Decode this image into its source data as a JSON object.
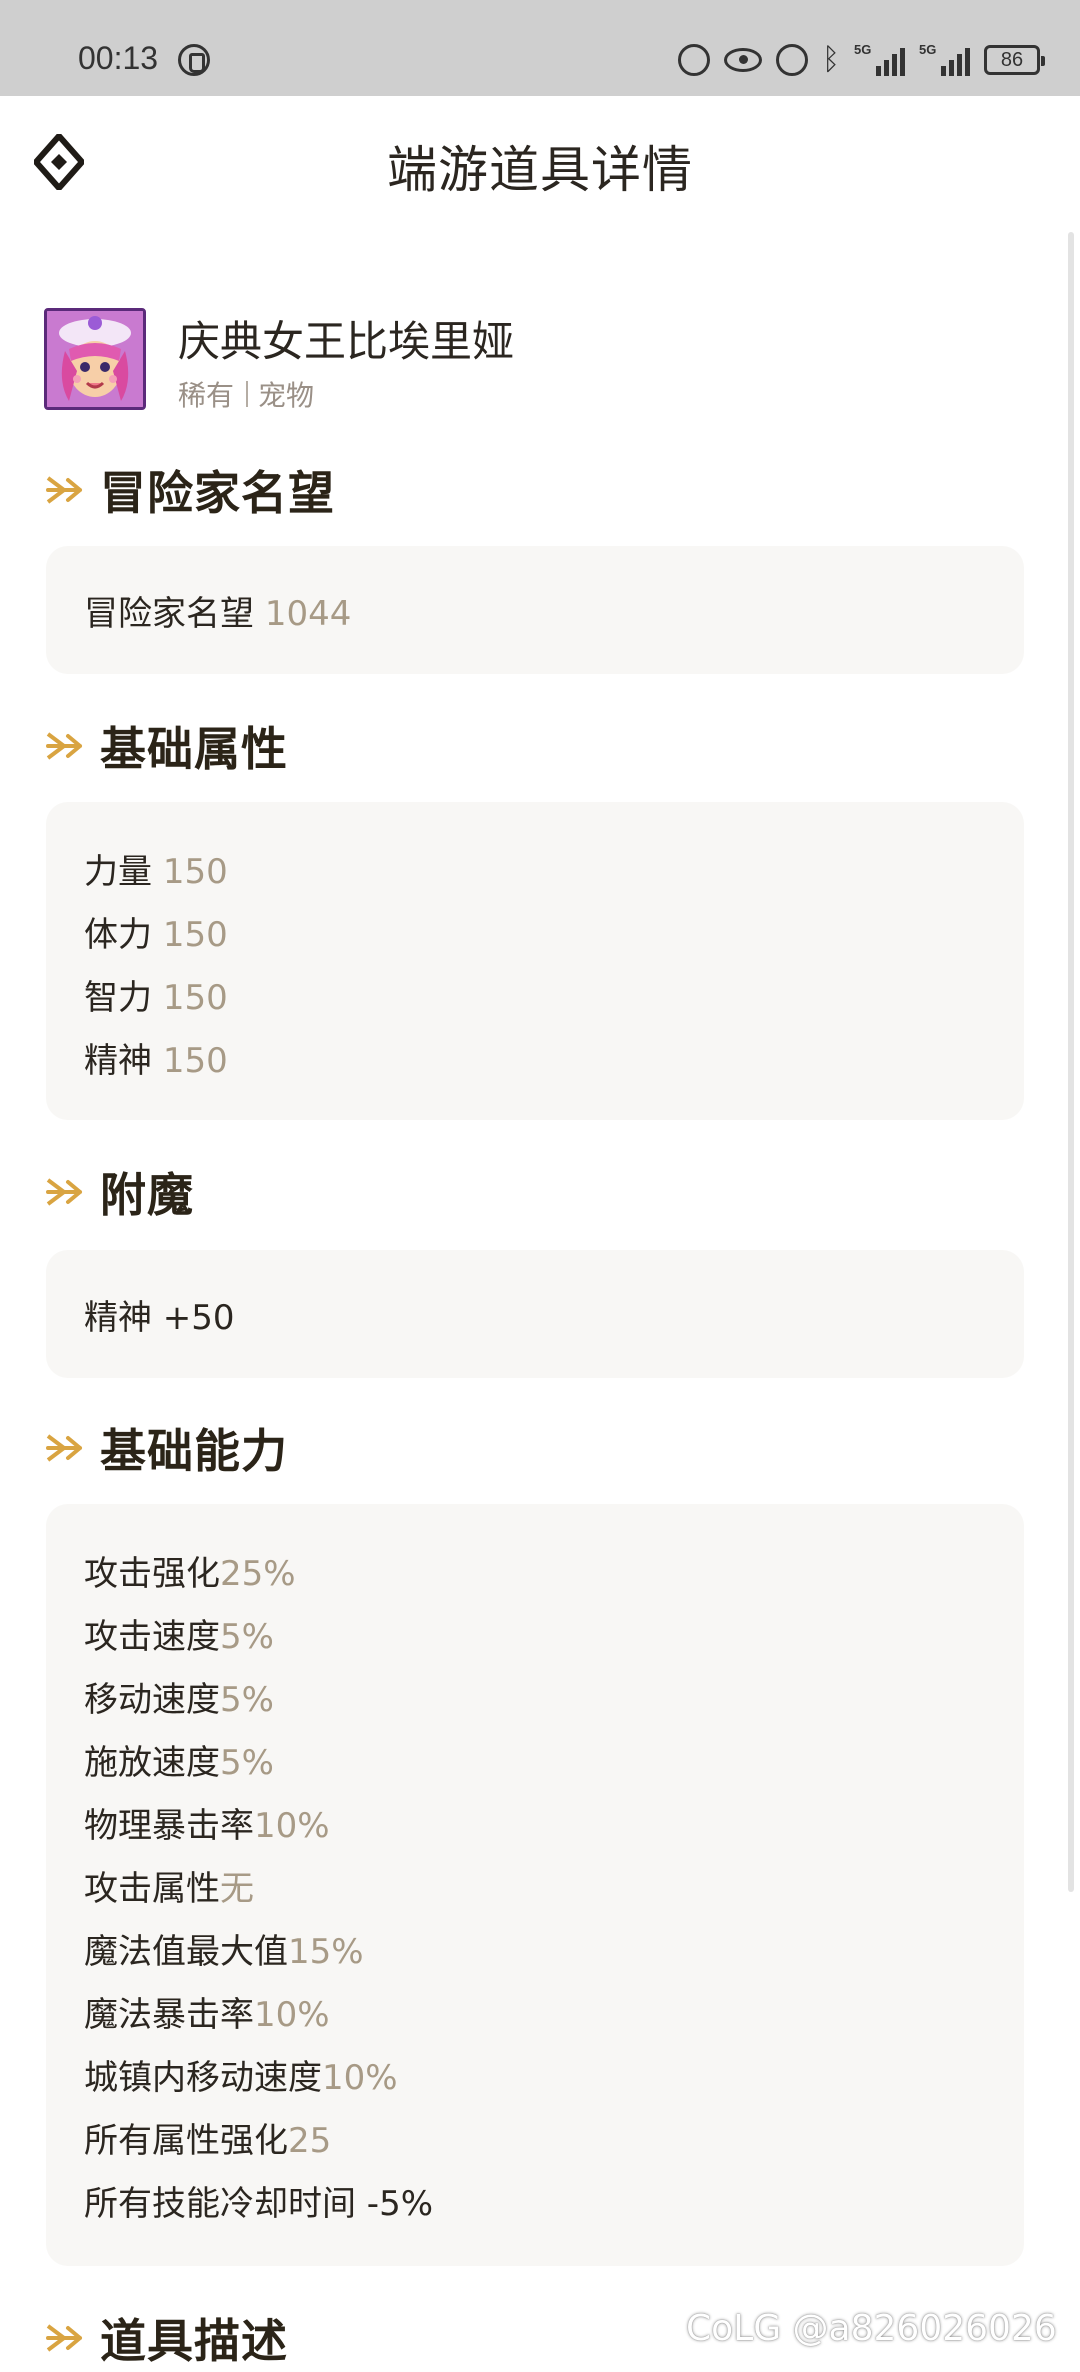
{
  "status_bar": {
    "time": "00:13",
    "network_label_1": "5G",
    "network_label_2": "5G",
    "battery": "86"
  },
  "header": {
    "title": "端游道具详情"
  },
  "item": {
    "name": "庆典女王比埃里娅",
    "rarity": "稀有",
    "category": "宠物"
  },
  "sections": {
    "reputation": {
      "title": "冒险家名望",
      "rows": [
        {
          "label": "冒险家名望",
          "value": "1044"
        }
      ]
    },
    "base_attributes": {
      "title": "基础属性",
      "rows": [
        {
          "label": "力量",
          "value": "150"
        },
        {
          "label": "体力",
          "value": "150"
        },
        {
          "label": "智力",
          "value": "150"
        },
        {
          "label": "精神",
          "value": "150"
        }
      ]
    },
    "enchant": {
      "title": "附魔",
      "rows": [
        {
          "text": "精神 +50"
        }
      ]
    },
    "base_abilities": {
      "title": "基础能力",
      "rows": [
        {
          "label": "攻击强化",
          "value": "25%"
        },
        {
          "label": "攻击速度",
          "value": "5%"
        },
        {
          "label": "移动速度",
          "value": "5%"
        },
        {
          "label": "施放速度",
          "value": "5%"
        },
        {
          "label": "物理暴击率",
          "value": "10%"
        },
        {
          "label": "攻击属性",
          "value": "无"
        },
        {
          "label": "魔法值最大值",
          "value": "15%"
        },
        {
          "label": "魔法暴击率",
          "value": "10%"
        },
        {
          "label": "城镇内移动速度",
          "value": "10%"
        },
        {
          "label": "所有属性强化",
          "value": "25"
        },
        {
          "text": "所有技能冷却时间 -5%"
        }
      ]
    },
    "description": {
      "title": "道具描述"
    }
  },
  "watermark": "CoLG @a826026026",
  "colors": {
    "accent_gold": "#d9a441",
    "value_text": "#a79a86",
    "card_bg": "#f8f7f5",
    "status_bar_bg": "#cfcfcf"
  },
  "icons": [
    "hand-icon",
    "data-saver-icon",
    "eye-icon",
    "alarm-icon",
    "bluetooth-icon",
    "signal-icon",
    "battery-icon",
    "app-logo-icon",
    "section-arrow-icon"
  ]
}
